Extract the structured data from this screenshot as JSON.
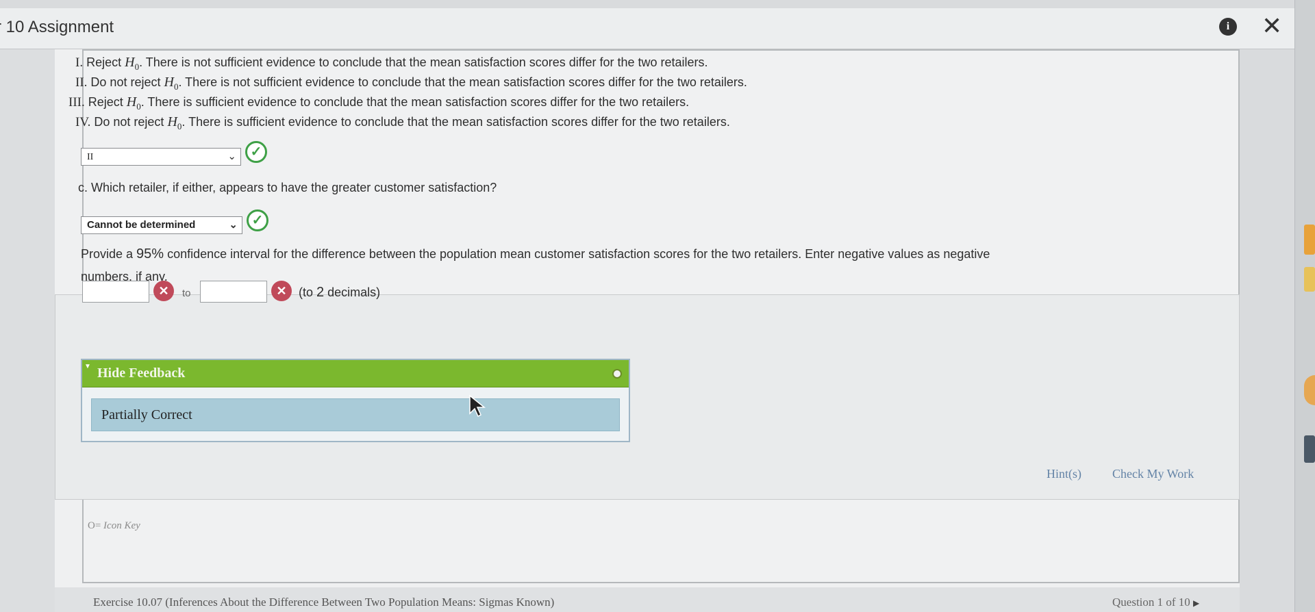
{
  "window": {
    "title": "r 10 Assignment",
    "info_icon": "info-icon",
    "close_icon": "close-icon"
  },
  "options": [
    {
      "numeral": "I.",
      "prefix": "Reject",
      "hyp": "H",
      "hyp_sub": "0",
      "text": ". There is not sufficient evidence to conclude that the mean satisfaction scores differ for the two retailers."
    },
    {
      "numeral": "II.",
      "prefix": "Do not reject",
      "hyp": "H",
      "hyp_sub": "0",
      "text": ". There is not sufficient evidence to conclude that the mean satisfaction scores differ for the two retailers."
    },
    {
      "numeral": "III.",
      "prefix": "Reject",
      "hyp": "H",
      "hyp_sub": "0",
      "text": ". There is sufficient evidence to conclude that the mean satisfaction scores differ for the two retailers."
    },
    {
      "numeral": "IV.",
      "prefix": "Do not reject",
      "hyp": "H",
      "hyp_sub": "0",
      "text": ". There is sufficient evidence to conclude that the mean satisfaction scores differ for the two retailers."
    }
  ],
  "answer_b": {
    "selected": "II"
  },
  "question_c": {
    "text": "c. Which retailer, if either, appears to have the greater customer satisfaction?",
    "selected": "Cannot be determined"
  },
  "ci": {
    "text_line1_a": "Provide a ",
    "text_pct": "95%",
    "text_line1_b": " confidence interval for the difference between the population mean customer satisfaction scores for the two retailers. Enter negative values as negative",
    "text_line2": "numbers, if any.",
    "lower_value": "",
    "upper_value": "",
    "to_label": "to",
    "decimals_a": "(to ",
    "decimals_num": "2",
    "decimals_b": " decimals)"
  },
  "feedback": {
    "toggle_label": "Hide Feedback",
    "result": "Partially Correct"
  },
  "actions": {
    "hint": "Hint(s)",
    "check": "Check My Work"
  },
  "icon_key": {
    "symbol": "O=",
    "label": "Icon Key"
  },
  "footer": {
    "exercise": "Exercise 10.07 (Inferences About the Difference Between Two Population Means: Sigmas Known)",
    "question": "Question 1 of 10"
  },
  "colors": {
    "correct": "#3ea046",
    "incorrect": "#c04a5a",
    "feedback_bar": "#7bb82e",
    "feedback_result": "#a9cbd8",
    "link": "#6383a6"
  }
}
